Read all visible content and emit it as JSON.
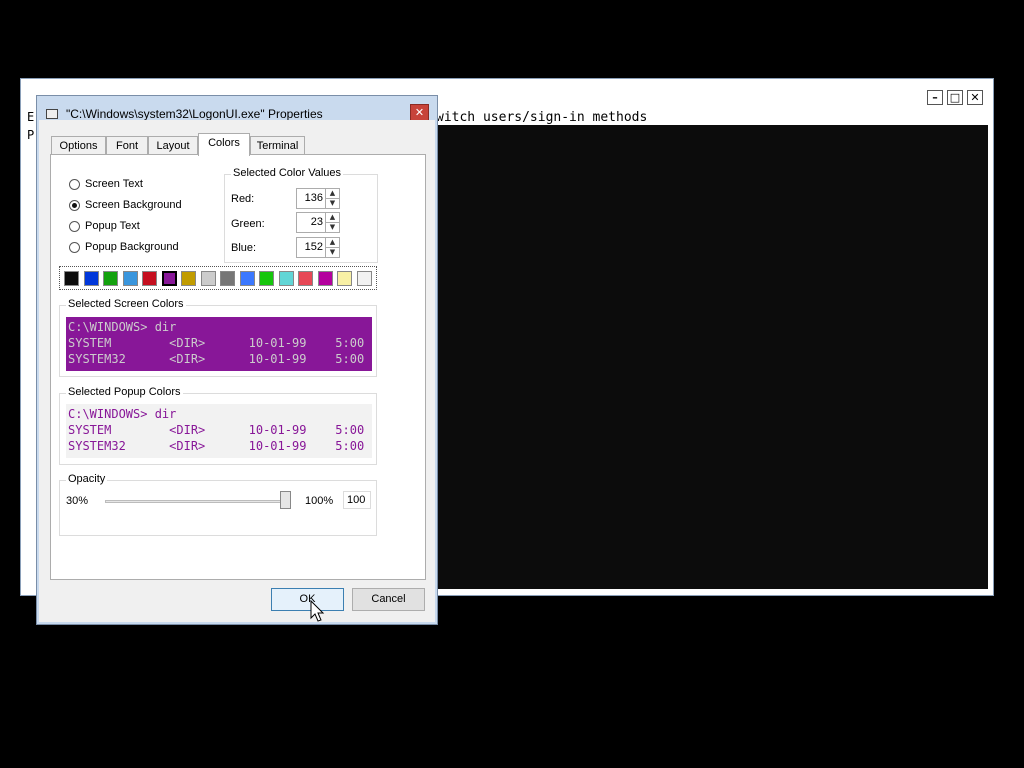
{
  "background_window": {
    "letters": [
      "E",
      "P"
    ],
    "command_text": "witch users/sign-in methods",
    "controls": {
      "minimize": "minimize-icon",
      "maximize": "maximize-icon",
      "close": "close-icon"
    }
  },
  "dialog": {
    "title": "\"C:\\Windows\\system32\\LogonUI.exe\" Properties",
    "close_icon": "close-icon",
    "tabs": [
      {
        "label": "Options"
      },
      {
        "label": "Font"
      },
      {
        "label": "Layout"
      },
      {
        "label": "Colors",
        "active": true
      },
      {
        "label": "Terminal"
      }
    ],
    "radios": [
      {
        "label": "Screen Text",
        "checked": false
      },
      {
        "label": "Screen Background",
        "checked": true
      },
      {
        "label": "Popup Text",
        "checked": false
      },
      {
        "label": "Popup Background",
        "checked": false
      }
    ],
    "color_values": {
      "group_label": "Selected Color Values",
      "red_label": "Red:",
      "red": "136",
      "green_label": "Green:",
      "green": "23",
      "blue_label": "Blue:",
      "blue": "152"
    },
    "palette": [
      "#0c0c0c",
      "#0037da",
      "#13a10e",
      "#3a96dd",
      "#c50f1f",
      "#881798",
      "#c19c00",
      "#cccccc",
      "#767676",
      "#3b78ff",
      "#16c60c",
      "#61d6d6",
      "#e74856",
      "#b4009e",
      "#f9f1a5",
      "#f2f2f2"
    ],
    "palette_selected_index": 5,
    "screen_colors": {
      "label": "Selected Screen Colors",
      "fg": "#cccccc",
      "bg": "#881798",
      "lines": [
        "C:\\WINDOWS> dir",
        "SYSTEM        <DIR>      10-01-99    5:00",
        "SYSTEM32      <DIR>      10-01-99    5:00"
      ]
    },
    "popup_colors": {
      "label": "Selected Popup Colors",
      "fg": "#881798",
      "bg": "#f2f2f2",
      "lines": [
        "C:\\WINDOWS> dir",
        "SYSTEM        <DIR>      10-01-99    5:00",
        "SYSTEM32      <DIR>      10-01-99    5:00"
      ]
    },
    "opacity": {
      "label": "Opacity",
      "min_label": "30%",
      "max_label": "100%",
      "value": "100",
      "level_fraction": 1.0
    },
    "buttons": {
      "ok": "OK",
      "cancel": "Cancel"
    }
  }
}
